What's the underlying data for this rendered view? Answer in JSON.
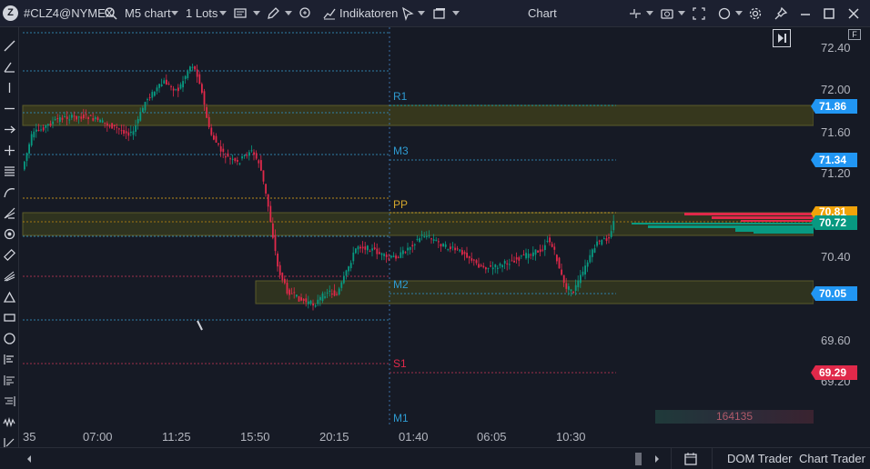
{
  "toolbar": {
    "logo": "Z",
    "symbol": "#CLZ4@NYMEX",
    "chart_type": "M5 chart",
    "lots": "1 Lots",
    "indicators": "Indikatoren",
    "title": "Chart"
  },
  "price_axis": {
    "labels": [
      "72.40",
      "72.00",
      "71.60",
      "71.20",
      "70.40",
      "69.60",
      "69.20"
    ],
    "tags": [
      {
        "value": "71.86",
        "color": "#2196f3"
      },
      {
        "value": "71.34",
        "color": "#2196f3"
      },
      {
        "value": "70.81",
        "color": "#f0a30a"
      },
      {
        "value": "70.72",
        "color": "#089981"
      },
      {
        "value": "70.05",
        "color": "#2196f3"
      },
      {
        "value": "69.29",
        "color": "#e0294a"
      }
    ]
  },
  "time_axis": [
    "35",
    "07:00",
    "11:25",
    "15:50",
    "20:15",
    "01:40",
    "06:05",
    "10:30"
  ],
  "pivots": {
    "r1": "R1",
    "m3": "M3",
    "pp": "PP",
    "m2": "M2",
    "s1": "S1",
    "m1": "M1"
  },
  "volume_box": "164135",
  "f_marker": "F",
  "bottombar": {
    "dom_trader": "DOM Trader",
    "chart_trader": "Chart Trader"
  },
  "colors": {
    "up": "#089981",
    "down": "#e0294a",
    "zone": "#4a4a1a",
    "accent": "#2196f3"
  }
}
